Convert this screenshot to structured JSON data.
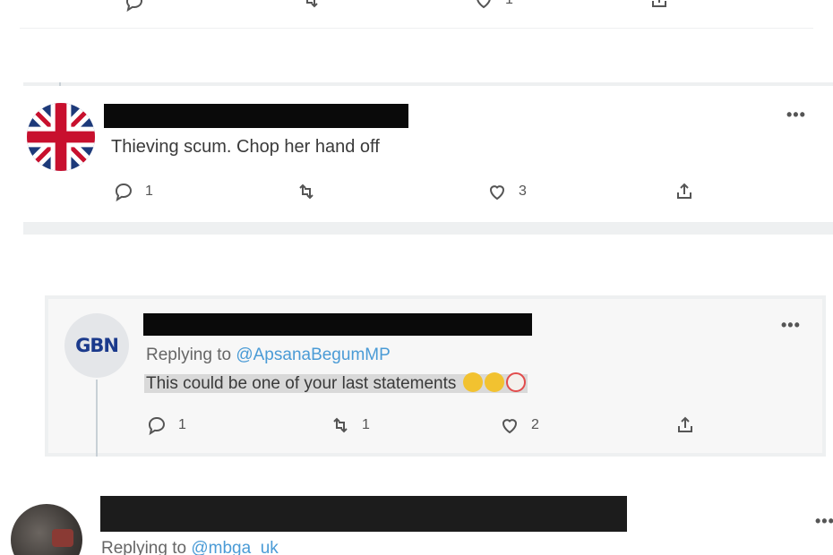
{
  "tweets": [
    {
      "text": "Thieving scum. Chop her hand off",
      "counts": {
        "reply": "1",
        "retweet": "",
        "like": "3"
      }
    },
    {
      "avatar_label": "GBN",
      "replying_prefix": "Replying to ",
      "replying_handle": "@ApsanaBegumMP",
      "text": "This could be one of your last statements",
      "counts": {
        "reply": "1",
        "retweet": "1",
        "like": "2"
      }
    },
    {
      "replying_prefix": "Replying to ",
      "replying_handle": "@mbga_uk"
    }
  ],
  "top_counts": {
    "like": "1"
  },
  "more_glyph": "•••",
  "colors": {
    "link": "#4a9bd6",
    "redaction": "#0a0a0a",
    "divider": "#eef0f1"
  }
}
